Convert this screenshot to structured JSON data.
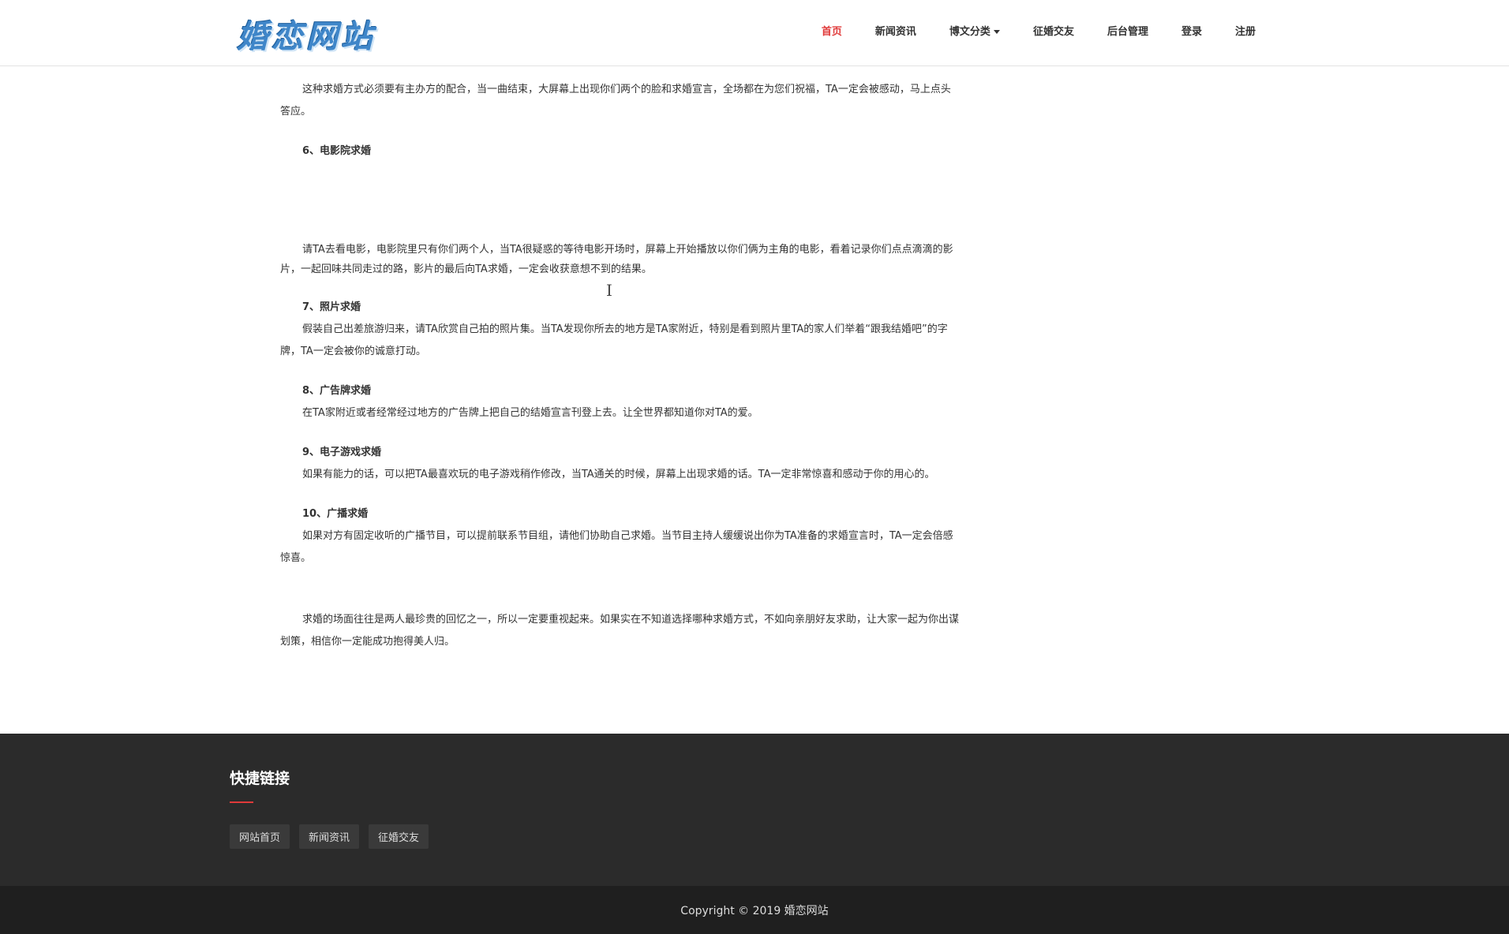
{
  "header": {
    "logo_text": "婚恋网站",
    "nav": [
      {
        "label": "首页",
        "active": true
      },
      {
        "label": "新闻资讯"
      },
      {
        "label": "博文分类"
      },
      {
        "label": "征婚交友"
      },
      {
        "label": "后台管理"
      },
      {
        "label": "登录"
      },
      {
        "label": "注册"
      }
    ]
  },
  "article": {
    "p1": "这种求婚方式必须要有主办方的配合，当一曲结束，大屏幕上出现你们两个的脸和求婚宣言，全场都在为您们祝福，TA一定会被感动，马上点头答应。",
    "s6_title": "6、电影院求婚",
    "s6_body": "请TA去看电影，电影院里只有你们两个人，当TA很疑惑的等待电影开场时，屏幕上开始播放以你们俩为主角的电影，看着记录你们点点滴滴的影片，一起回味共同走过的路，影片的最后向TA求婚，一定会收获意想不到的结果。",
    "s7_title": "7、照片求婚",
    "s7_body": "假装自己出差旅游归来，请TA欣赏自己拍的照片集。当TA发现你所去的地方是TA家附近，特别是看到照片里TA的家人们举着“跟我结婚吧”的字牌，TA一定会被你的诚意打动。",
    "s8_title": "8、广告牌求婚",
    "s8_body": "在TA家附近或者经常经过地方的广告牌上把自己的结婚宣言刊登上去。让全世界都知道你对TA的爱。",
    "s9_title": "9、电子游戏求婚",
    "s9_body": "如果有能力的话，可以把TA最喜欢玩的电子游戏稍作修改，当TA通关的时候，屏幕上出现求婚的话。TA一定非常惊喜和感动于你的用心的。",
    "s10_title": "10、广播求婚",
    "s10_body": "如果对方有固定收听的广播节目，可以提前联系节目组，请他们协助自己求婚。当节目主持人缓缓说出你为TA准备的求婚宣言时，TA一定会倍感惊喜。",
    "closing": "求婚的场面往往是两人最珍贵的回忆之一，所以一定要重视起来。如果实在不知道选择哪种求婚方式，不如向亲朋好友求助，让大家一起为你出谋划策，相信你一定能成功抱得美人归。"
  },
  "footer": {
    "title": "快捷链接",
    "links": [
      "网站首页",
      "新闻资讯",
      "征婚交友"
    ],
    "copyright": "Copyright © 2019 婚恋网站"
  },
  "colors": {
    "accent": "#e03a3a",
    "footer_bg": "#2b2b2b",
    "bottom_bg": "#1f1f1f",
    "logo": "#3f86c9"
  },
  "icons": [
    "caret-down-icon",
    "text-cursor-icon"
  ]
}
